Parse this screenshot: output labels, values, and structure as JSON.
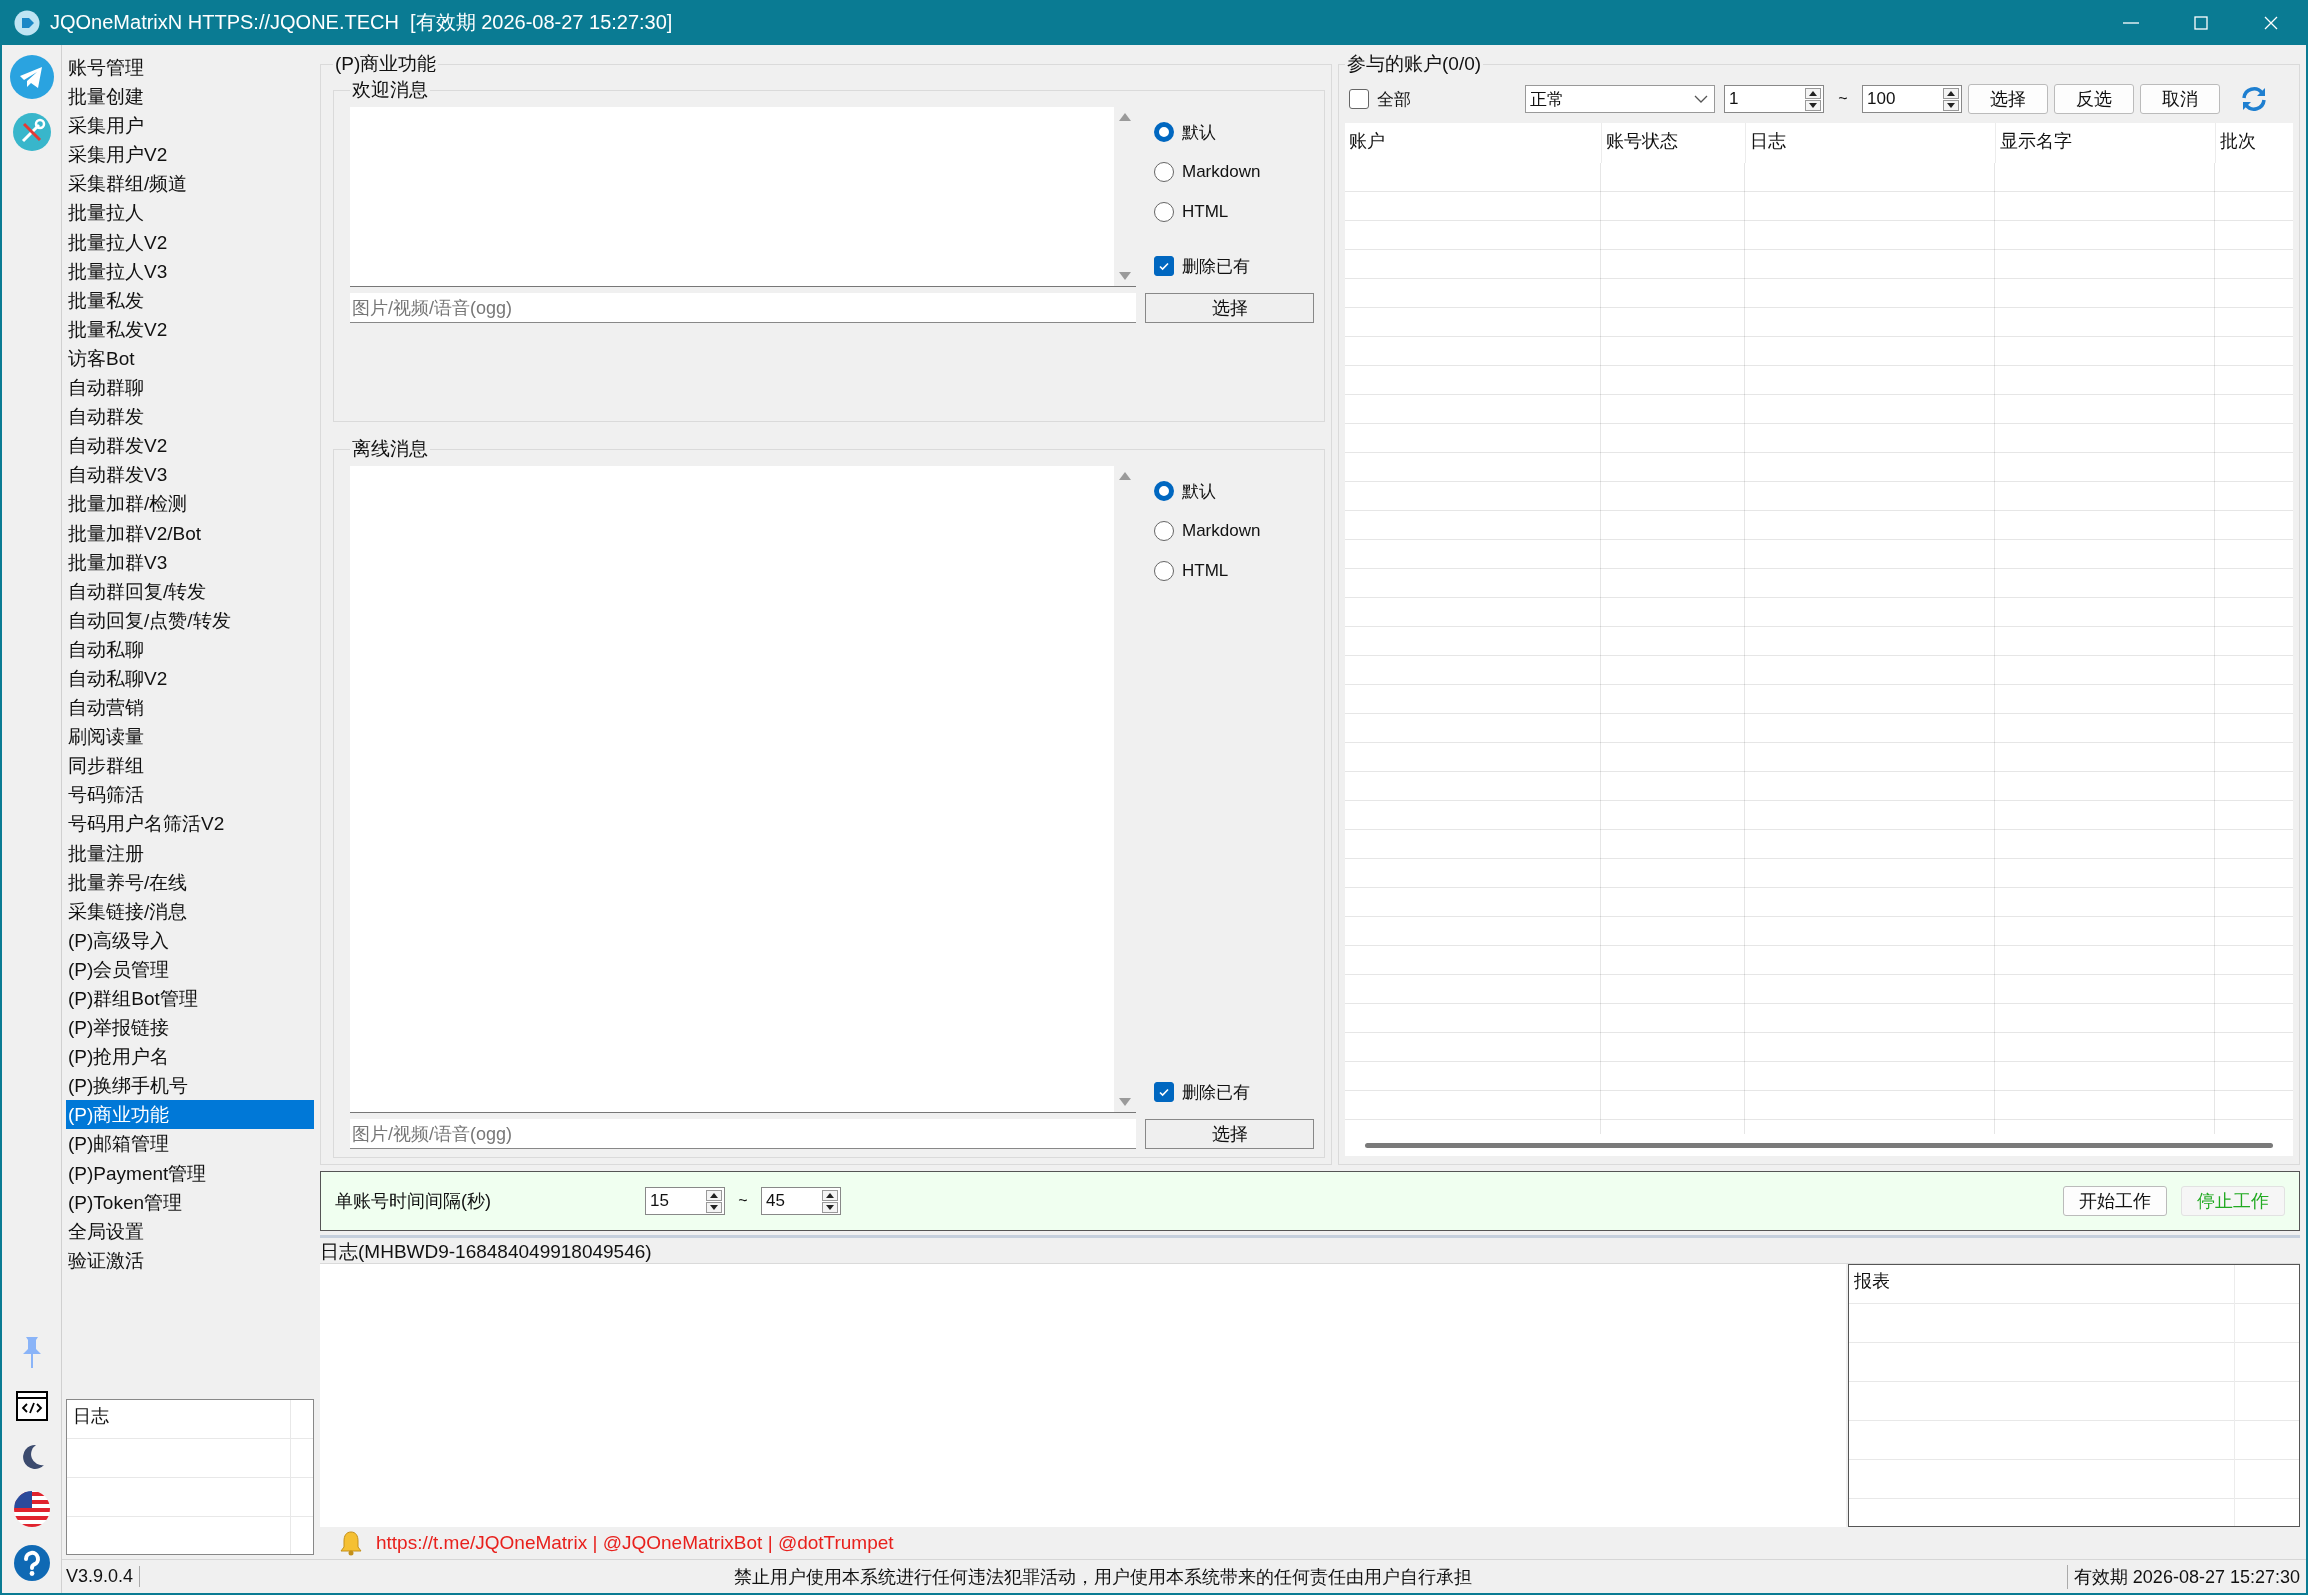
{
  "window": {
    "title": "JQOneMatrixN HTTPS://JQONE.TECH  [有效期 2026-08-27 15:27:30]"
  },
  "sidebar": {
    "items": [
      {
        "label": "账号管理",
        "selected": false
      },
      {
        "label": "批量创建",
        "selected": false
      },
      {
        "label": "采集用户",
        "selected": false
      },
      {
        "label": "采集用户V2",
        "selected": false
      },
      {
        "label": "采集群组/频道",
        "selected": false
      },
      {
        "label": "批量拉人",
        "selected": false
      },
      {
        "label": "批量拉人V2",
        "selected": false
      },
      {
        "label": "批量拉人V3",
        "selected": false
      },
      {
        "label": "批量私发",
        "selected": false
      },
      {
        "label": "批量私发V2",
        "selected": false
      },
      {
        "label": "访客Bot",
        "selected": false
      },
      {
        "label": "自动群聊",
        "selected": false
      },
      {
        "label": "自动群发",
        "selected": false
      },
      {
        "label": "自动群发V2",
        "selected": false
      },
      {
        "label": "自动群发V3",
        "selected": false
      },
      {
        "label": "批量加群/检测",
        "selected": false
      },
      {
        "label": "批量加群V2/Bot",
        "selected": false
      },
      {
        "label": "批量加群V3",
        "selected": false
      },
      {
        "label": "自动群回复/转发",
        "selected": false
      },
      {
        "label": "自动回复/点赞/转发",
        "selected": false
      },
      {
        "label": "自动私聊",
        "selected": false
      },
      {
        "label": "自动私聊V2",
        "selected": false
      },
      {
        "label": "自动营销",
        "selected": false
      },
      {
        "label": "刷阅读量",
        "selected": false
      },
      {
        "label": "同步群组",
        "selected": false
      },
      {
        "label": "号码筛活",
        "selected": false
      },
      {
        "label": "号码用户名筛活V2",
        "selected": false
      },
      {
        "label": "批量注册",
        "selected": false
      },
      {
        "label": "批量养号/在线",
        "selected": false
      },
      {
        "label": "采集链接/消息",
        "selected": false
      },
      {
        "label": "(P)高级导入",
        "selected": false
      },
      {
        "label": "(P)会员管理",
        "selected": false
      },
      {
        "label": "(P)群组Bot管理",
        "selected": false
      },
      {
        "label": "(P)举报链接",
        "selected": false
      },
      {
        "label": "(P)抢用户名",
        "selected": false
      },
      {
        "label": "(P)换绑手机号",
        "selected": false
      },
      {
        "label": "(P)商业功能",
        "selected": true
      },
      {
        "label": "(P)邮箱管理",
        "selected": false
      },
      {
        "label": "(P)Payment管理",
        "selected": false
      },
      {
        "label": "(P)Token管理",
        "selected": false
      },
      {
        "label": "全局设置",
        "selected": false
      },
      {
        "label": "验证激活",
        "selected": false
      }
    ],
    "log_table": {
      "columns": [
        "日志"
      ]
    }
  },
  "feature_panel": {
    "title": "(P)商业功能",
    "sections": [
      {
        "title": "欢迎消息",
        "format_options": [
          {
            "label": "默认",
            "selected": true
          },
          {
            "label": "Markdown",
            "selected": false
          },
          {
            "label": "HTML",
            "selected": false
          }
        ],
        "delete_existing": {
          "label": "删除已有",
          "checked": true
        },
        "media_field": {
          "placeholder": "图片/视频/语音(ogg)"
        },
        "choose_button": "选择"
      },
      {
        "title": "离线消息",
        "format_options": [
          {
            "label": "默认",
            "selected": true
          },
          {
            "label": "Markdown",
            "selected": false
          },
          {
            "label": "HTML",
            "selected": false
          }
        ],
        "delete_existing": {
          "label": "删除已有",
          "checked": true
        },
        "media_field": {
          "placeholder": "图片/视频/语音(ogg)"
        },
        "choose_button": "选择"
      }
    ]
  },
  "accounts": {
    "title": "参与的账户(0/0)",
    "all_checkbox": {
      "label": "全部",
      "checked": false
    },
    "status_select": "正常",
    "range_from": "1",
    "range_separator": "~",
    "range_to": "100",
    "buttons": [
      "选择",
      "反选",
      "取消"
    ],
    "table": {
      "columns": [
        "账户",
        "账号状态",
        "日志",
        "显示名字",
        "批次"
      ]
    }
  },
  "interval_bar": {
    "label": "单账号时间间隔(秒)",
    "from": "15",
    "separator": "~",
    "to": "45",
    "start_button": "开始工作",
    "stop_button": "停止工作"
  },
  "log": {
    "title": "日志(MHBWD9-168484049918049546)",
    "report_table": {
      "columns": [
        "报表"
      ]
    }
  },
  "links": "https://t.me/JQOneMatrix | @JQOneMatrixBot | @dotTrumpet",
  "status_bar": {
    "version": "V3.9.0.4",
    "notice": "禁止用户使用本系统进行任何违法犯罪活动，用户使用本系统带来的任何责任由用户自行承担",
    "expiry": "有效期 2026-08-27 15:27:30"
  }
}
